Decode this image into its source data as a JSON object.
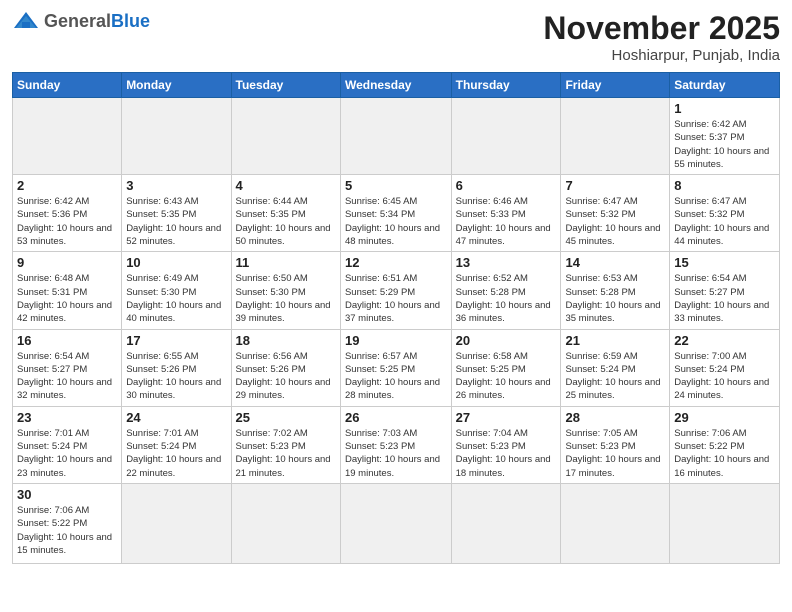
{
  "header": {
    "logo_general": "General",
    "logo_blue": "Blue",
    "month_title": "November 2025",
    "subtitle": "Hoshiarpur, Punjab, India"
  },
  "days_of_week": [
    "Sunday",
    "Monday",
    "Tuesday",
    "Wednesday",
    "Thursday",
    "Friday",
    "Saturday"
  ],
  "weeks": [
    [
      {
        "day": null,
        "info": null
      },
      {
        "day": null,
        "info": null
      },
      {
        "day": null,
        "info": null
      },
      {
        "day": null,
        "info": null
      },
      {
        "day": null,
        "info": null
      },
      {
        "day": null,
        "info": null
      },
      {
        "day": "1",
        "info": "Sunrise: 6:42 AM\nSunset: 5:37 PM\nDaylight: 10 hours and 55 minutes."
      }
    ],
    [
      {
        "day": "2",
        "info": "Sunrise: 6:42 AM\nSunset: 5:36 PM\nDaylight: 10 hours and 53 minutes."
      },
      {
        "day": "3",
        "info": "Sunrise: 6:43 AM\nSunset: 5:35 PM\nDaylight: 10 hours and 52 minutes."
      },
      {
        "day": "4",
        "info": "Sunrise: 6:44 AM\nSunset: 5:35 PM\nDaylight: 10 hours and 50 minutes."
      },
      {
        "day": "5",
        "info": "Sunrise: 6:45 AM\nSunset: 5:34 PM\nDaylight: 10 hours and 48 minutes."
      },
      {
        "day": "6",
        "info": "Sunrise: 6:46 AM\nSunset: 5:33 PM\nDaylight: 10 hours and 47 minutes."
      },
      {
        "day": "7",
        "info": "Sunrise: 6:47 AM\nSunset: 5:32 PM\nDaylight: 10 hours and 45 minutes."
      },
      {
        "day": "8",
        "info": "Sunrise: 6:47 AM\nSunset: 5:32 PM\nDaylight: 10 hours and 44 minutes."
      }
    ],
    [
      {
        "day": "9",
        "info": "Sunrise: 6:48 AM\nSunset: 5:31 PM\nDaylight: 10 hours and 42 minutes."
      },
      {
        "day": "10",
        "info": "Sunrise: 6:49 AM\nSunset: 5:30 PM\nDaylight: 10 hours and 40 minutes."
      },
      {
        "day": "11",
        "info": "Sunrise: 6:50 AM\nSunset: 5:30 PM\nDaylight: 10 hours and 39 minutes."
      },
      {
        "day": "12",
        "info": "Sunrise: 6:51 AM\nSunset: 5:29 PM\nDaylight: 10 hours and 37 minutes."
      },
      {
        "day": "13",
        "info": "Sunrise: 6:52 AM\nSunset: 5:28 PM\nDaylight: 10 hours and 36 minutes."
      },
      {
        "day": "14",
        "info": "Sunrise: 6:53 AM\nSunset: 5:28 PM\nDaylight: 10 hours and 35 minutes."
      },
      {
        "day": "15",
        "info": "Sunrise: 6:54 AM\nSunset: 5:27 PM\nDaylight: 10 hours and 33 minutes."
      }
    ],
    [
      {
        "day": "16",
        "info": "Sunrise: 6:54 AM\nSunset: 5:27 PM\nDaylight: 10 hours and 32 minutes."
      },
      {
        "day": "17",
        "info": "Sunrise: 6:55 AM\nSunset: 5:26 PM\nDaylight: 10 hours and 30 minutes."
      },
      {
        "day": "18",
        "info": "Sunrise: 6:56 AM\nSunset: 5:26 PM\nDaylight: 10 hours and 29 minutes."
      },
      {
        "day": "19",
        "info": "Sunrise: 6:57 AM\nSunset: 5:25 PM\nDaylight: 10 hours and 28 minutes."
      },
      {
        "day": "20",
        "info": "Sunrise: 6:58 AM\nSunset: 5:25 PM\nDaylight: 10 hours and 26 minutes."
      },
      {
        "day": "21",
        "info": "Sunrise: 6:59 AM\nSunset: 5:24 PM\nDaylight: 10 hours and 25 minutes."
      },
      {
        "day": "22",
        "info": "Sunrise: 7:00 AM\nSunset: 5:24 PM\nDaylight: 10 hours and 24 minutes."
      }
    ],
    [
      {
        "day": "23",
        "info": "Sunrise: 7:01 AM\nSunset: 5:24 PM\nDaylight: 10 hours and 23 minutes."
      },
      {
        "day": "24",
        "info": "Sunrise: 7:01 AM\nSunset: 5:24 PM\nDaylight: 10 hours and 22 minutes."
      },
      {
        "day": "25",
        "info": "Sunrise: 7:02 AM\nSunset: 5:23 PM\nDaylight: 10 hours and 21 minutes."
      },
      {
        "day": "26",
        "info": "Sunrise: 7:03 AM\nSunset: 5:23 PM\nDaylight: 10 hours and 19 minutes."
      },
      {
        "day": "27",
        "info": "Sunrise: 7:04 AM\nSunset: 5:23 PM\nDaylight: 10 hours and 18 minutes."
      },
      {
        "day": "28",
        "info": "Sunrise: 7:05 AM\nSunset: 5:23 PM\nDaylight: 10 hours and 17 minutes."
      },
      {
        "day": "29",
        "info": "Sunrise: 7:06 AM\nSunset: 5:22 PM\nDaylight: 10 hours and 16 minutes."
      }
    ],
    [
      {
        "day": "30",
        "info": "Sunrise: 7:06 AM\nSunset: 5:22 PM\nDaylight: 10 hours and 15 minutes."
      },
      {
        "day": null,
        "info": null
      },
      {
        "day": null,
        "info": null
      },
      {
        "day": null,
        "info": null
      },
      {
        "day": null,
        "info": null
      },
      {
        "day": null,
        "info": null
      },
      {
        "day": null,
        "info": null
      }
    ]
  ]
}
